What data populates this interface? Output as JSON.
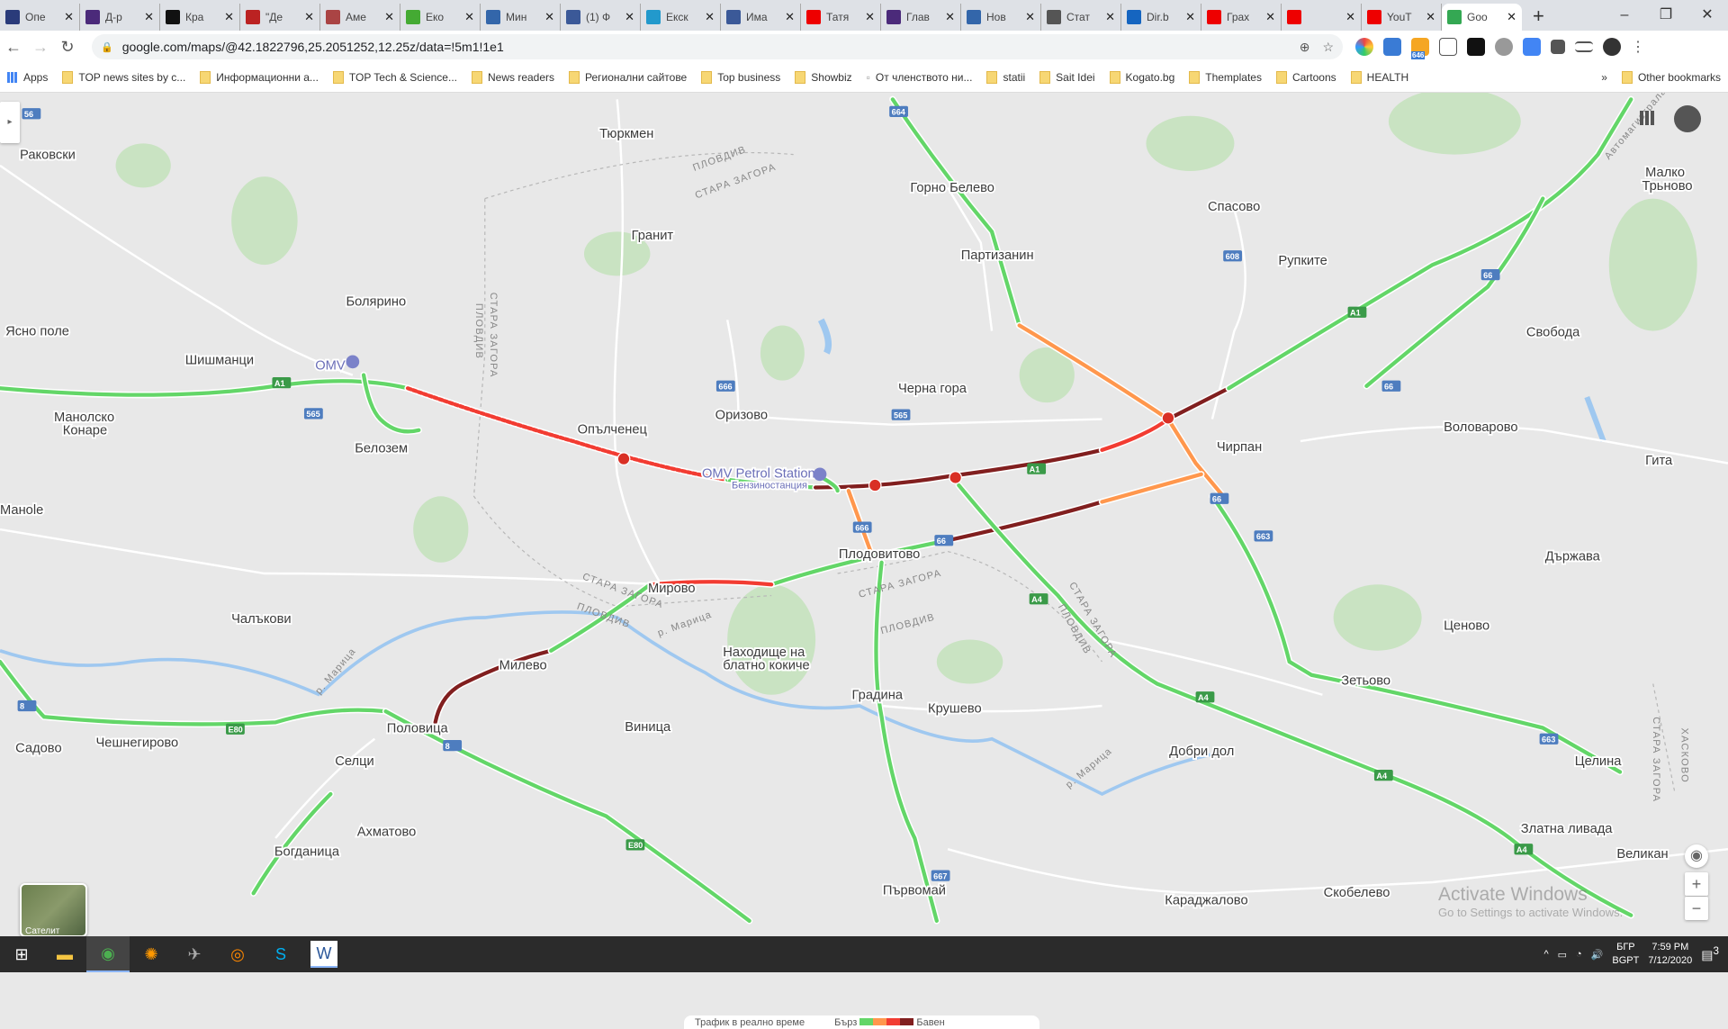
{
  "browser": {
    "tabs": [
      {
        "title": "Опе",
        "color": "#2a3b7a"
      },
      {
        "title": "Д-р",
        "color": "#4b2a7a"
      },
      {
        "title": "Кра",
        "color": "#111"
      },
      {
        "title": "\"Де",
        "color": "#b22"
      },
      {
        "title": "Аме",
        "color": "#a44"
      },
      {
        "title": "Еко",
        "color": "#4a3"
      },
      {
        "title": "Мин",
        "color": "#36a"
      },
      {
        "title": "(1) Ф",
        "color": "#3b5998"
      },
      {
        "title": "Екск",
        "color": "#29c"
      },
      {
        "title": "Има",
        "color": "#3b5998"
      },
      {
        "title": "Татя",
        "color": "#e00"
      },
      {
        "title": "Глав",
        "color": "#4b2a7a"
      },
      {
        "title": "Нов",
        "color": "#36a"
      },
      {
        "title": "Стат",
        "color": "#555"
      },
      {
        "title": "Dir.b",
        "color": "#1565c0"
      },
      {
        "title": "Грах",
        "color": "#e00"
      },
      {
        "title": "",
        "color": "#e00"
      },
      {
        "title": "YouT",
        "color": "#e00"
      },
      {
        "title": "Goo",
        "color": "#34a853",
        "active": true
      }
    ],
    "url": "google.com/maps/@42.1822796,25.2051252,12.25z/data=!5m1!1e1",
    "extension_badge": "646",
    "bookmarks": [
      "Apps",
      "TOP news sites by c...",
      "Информационни а...",
      "TOP Tech & Science...",
      "News readers",
      "Регионални сайтове",
      "Top business",
      "Showbiz",
      "От членството ни...",
      "statii",
      "Sait Idei",
      "Kogato.bg",
      "Themplates",
      "Cartoons",
      "HEALTH"
    ],
    "other_bookmarks": "Other bookmarks"
  },
  "map": {
    "places": [
      "Раковски",
      "Тюркмен",
      "Горно Белево",
      "Спасово",
      "Малко",
      "Трьново",
      "Гранит",
      "Партизанин",
      "Рупките",
      "Болярино",
      "Ясно поле",
      "Шишманци",
      "Свобода",
      "Черна гора",
      "Оризово",
      "Опълченец",
      "Манолско",
      "Конаре",
      "Белозем",
      "Чирпан",
      "Воловарово",
      "Гита",
      "Манole",
      "Плодовитово",
      "Държава",
      "Мирово",
      "Чалъкови",
      "Ценово",
      "Находище на",
      "блатно кокиче",
      "Милево",
      "Зетьово",
      "Градина",
      "Крушево",
      "Виница",
      "Садово",
      "Чешнегирово",
      "Половица",
      "Селци",
      "Добри дол",
      "Целина",
      "Ахматово",
      "Богданица",
      "Златна ливада",
      "Великан",
      "Първомай",
      "Караджалово",
      "Скобелево"
    ],
    "poi": [
      "OMV",
      "OMV Petrol Station",
      "Бензиностанция"
    ],
    "region_labels": [
      "ПЛОВДИВ",
      "СТАРА ЗАГОРА",
      "СТАРА ЗАГОРА",
      "ПЛОВДИВ",
      "СТАРА ЗАГОРА",
      "ПЛОВДИВ",
      "СТАРА ЗАГОРА",
      "ПЛОВДИВ",
      "СТАРА ЗАГОРА",
      "ПЛОВДИВ",
      "СТАРА ЗАГОРА",
      "ХАСКОВО",
      "Автомагистрала Тракия",
      "р. Марица",
      "р. Марица",
      "р. Марица"
    ],
    "road_shields": [
      "A1",
      "565",
      "664",
      "666",
      "608",
      "66",
      "663",
      "E80",
      "8",
      "A4",
      "667",
      "56",
      "A1",
      "A4",
      "66",
      "565",
      "666",
      "66",
      "663",
      "E80",
      "8",
      "A4",
      "A1",
      "66",
      "A4"
    ],
    "traffic_colors": {
      "fast": "#63d668",
      "medium": "#ff974d",
      "slow": "#f23c32",
      "heavy": "#811f1f"
    },
    "legend": {
      "title": "Трафик в реално време",
      "fast": "Бърз",
      "slow": "Бавен"
    },
    "satellite_label": "Сателит"
  },
  "watermark": {
    "line1": "Activate Windows",
    "line2": "Go to Settings to activate Windows."
  },
  "taskbar": {
    "lang1": "БГР",
    "lang2": "BGPT",
    "time": "7:59 PM",
    "date": "7/12/2020",
    "notifications": "3"
  }
}
